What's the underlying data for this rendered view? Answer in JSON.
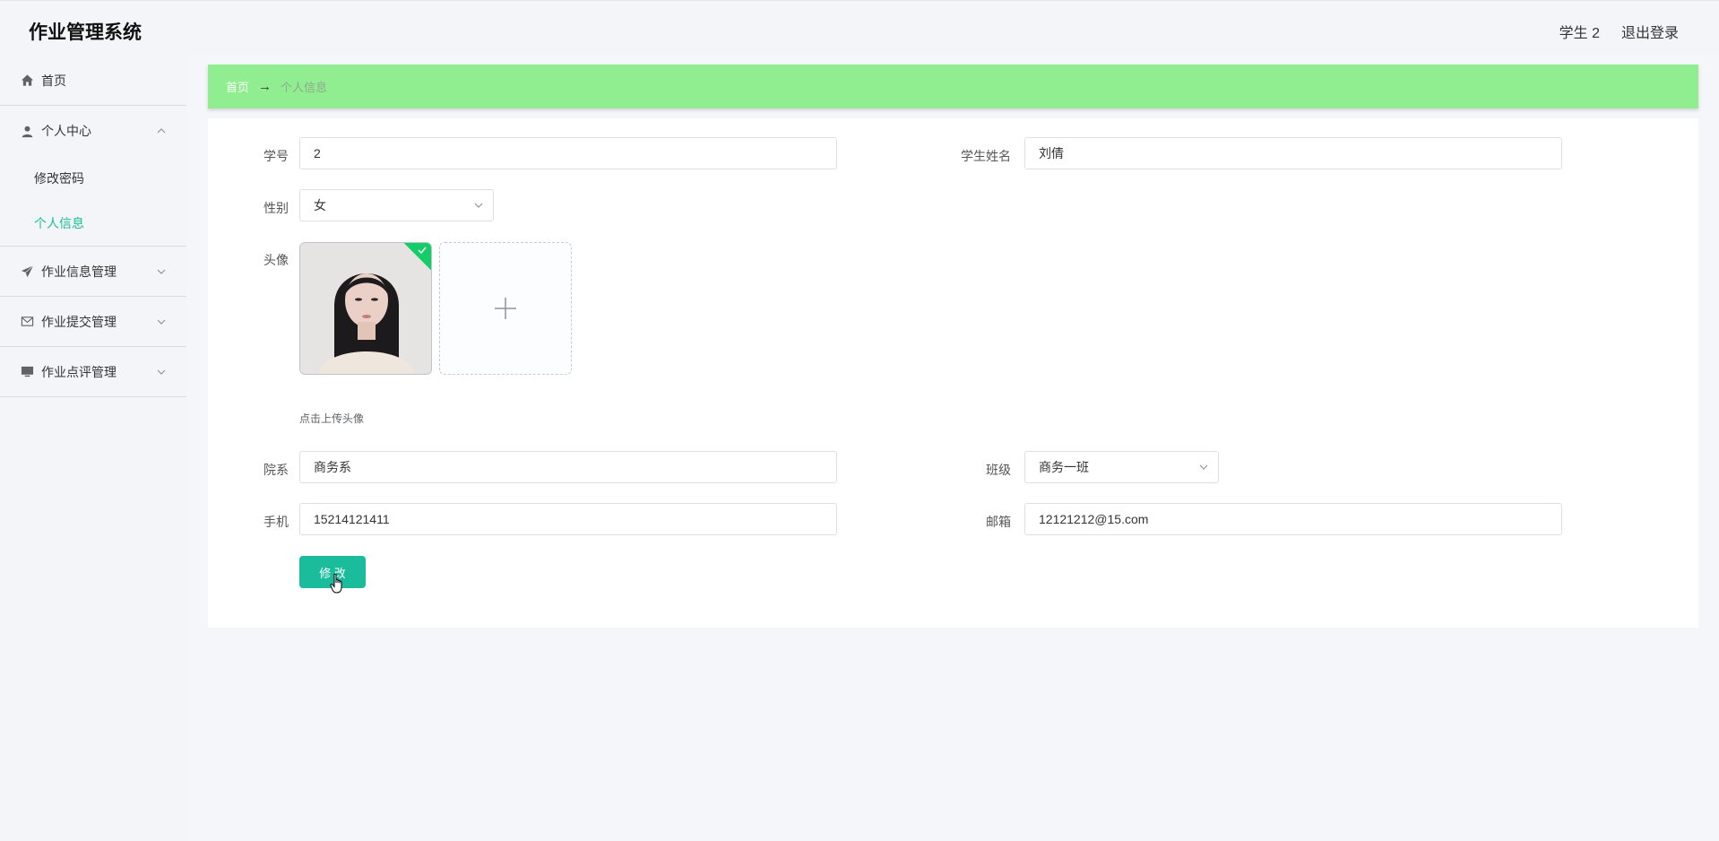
{
  "header": {
    "title": "作业管理系统",
    "user": "学生 2",
    "logout": "退出登录"
  },
  "sidebar": {
    "items": [
      {
        "label": "首页",
        "icon": "home-icon"
      },
      {
        "label": "个人中心",
        "icon": "user-icon",
        "expanded": true,
        "children": [
          {
            "label": "修改密码"
          },
          {
            "label": "个人信息",
            "active": true
          }
        ]
      },
      {
        "label": "作业信息管理",
        "icon": "paper-plane-icon"
      },
      {
        "label": "作业提交管理",
        "icon": "envelope-icon"
      },
      {
        "label": "作业点评管理",
        "icon": "monitor-icon"
      }
    ]
  },
  "breadcrumb": {
    "home": "首页",
    "arrow": "→",
    "current": "个人信息"
  },
  "form": {
    "student_id": {
      "label": "学号",
      "value": "2"
    },
    "student_name": {
      "label": "学生姓名",
      "value": "刘倩"
    },
    "gender": {
      "label": "性别",
      "value": "女"
    },
    "avatar": {
      "label": "头像",
      "tip": "点击上传头像"
    },
    "department": {
      "label": "院系",
      "value": "商务系"
    },
    "class": {
      "label": "班级",
      "value": "商务一班"
    },
    "phone": {
      "label": "手机",
      "value": "15214121411"
    },
    "email": {
      "label": "邮箱",
      "value": "12121212@15.com"
    },
    "submit": "修 改"
  },
  "colors": {
    "accent": "#1abc9c",
    "breadcrumb_bg": "#90ee90",
    "success": "#13ce66"
  }
}
